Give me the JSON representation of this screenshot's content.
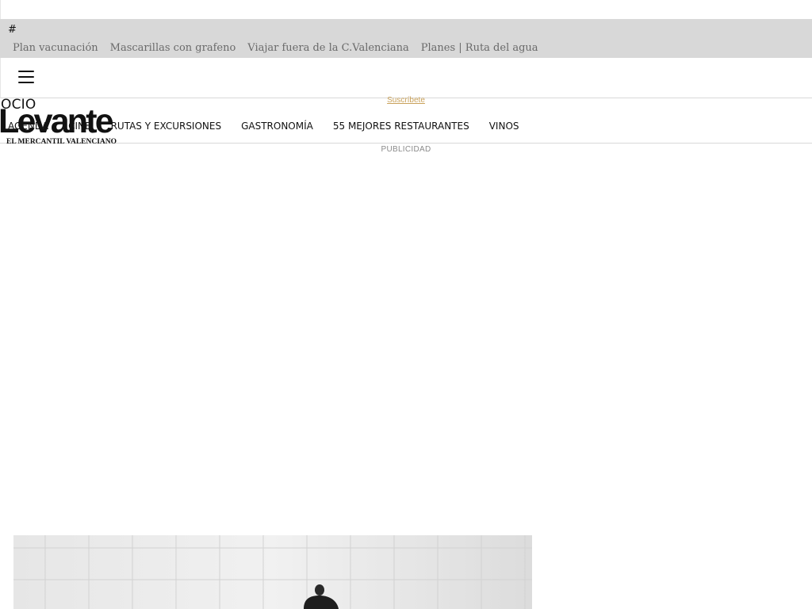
{
  "top_hash": "#",
  "trending": {
    "links": [
      "Plan vacunación",
      "Mascarillas con grafeno",
      "Viajar fuera de la C.Valenciana",
      "Planes | Ruta del agua"
    ]
  },
  "header": {
    "menu_icon": "hamburger-menu-icon",
    "subscribe_label": "Suscríbete"
  },
  "section": {
    "title": "OCIO"
  },
  "logo": {
    "wordmark": "Levante",
    "tagline": "EL MERCANTIL VALENCIANO"
  },
  "nav": {
    "items": [
      "AGENDA",
      "CINE",
      "RUTAS Y EXCURSIONES",
      "GASTRONOMÍA",
      "55 MEJORES RESTAURANTES",
      "VINOS"
    ]
  },
  "ad": {
    "label": "PUBLICIDAD"
  },
  "colors": {
    "trending_bg": "#d8d8d8",
    "subscribe": "#c9a15a",
    "nav_text": "#111111"
  }
}
